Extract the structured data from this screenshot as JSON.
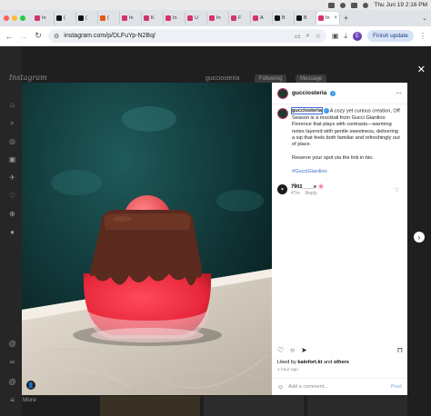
{
  "menubar": {
    "datetime": "Thu Jun 19  2:16 PM"
  },
  "tabs": [
    {
      "label": "In",
      "color": "#d6336c"
    },
    {
      "label": "(",
      "color": "#111111"
    },
    {
      "label": "(",
      "color": "#111111"
    },
    {
      "label": "(",
      "color": "#e8590c"
    },
    {
      "label": "In",
      "color": "#d6336c"
    },
    {
      "label": "K",
      "color": "#d6336c"
    },
    {
      "label": "In",
      "color": "#d6336c"
    },
    {
      "label": "U",
      "color": "#d6336c"
    },
    {
      "label": "In",
      "color": "#d6336c"
    },
    {
      "label": "F",
      "color": "#d6336c"
    },
    {
      "label": "A",
      "color": "#d6336c"
    },
    {
      "label": "B",
      "color": "#111111"
    },
    {
      "label": "B",
      "color": "#111111"
    },
    {
      "label": "In",
      "color": "#d6336c"
    }
  ],
  "toolbar": {
    "url": "instagram.com/p/DLFuYp-N2Bq/",
    "profile_initial": "E",
    "finish_update": "Finish update"
  },
  "page": {
    "logo": "Instagram",
    "bg_username": "gucciosteria",
    "bg_following": "Following",
    "bg_message": "Message",
    "more": "More"
  },
  "post": {
    "username": "gucciosteria",
    "caption_user": "gucciosteria",
    "caption": "A cozy yet curious creation, Off Season is a mocktail from Gucci Giardino Florence that plays with contrasts—warming notes layered with gentle sweetness, delivering a sip that feels both familiar and refreshingly out of place.",
    "caption2": "Reserve your spot via the link in bio.",
    "hashtag": "#GucciGiardino",
    "caption_age": "1h",
    "comment_user": "7902____x",
    "comment_emoji": "🌸",
    "comment_age": "47m",
    "reply": "Reply",
    "liked_prefix": "Liked by ",
    "liked_user": "kainfort.kt",
    "liked_and": " and ",
    "liked_others": "others",
    "post_age": "1 hour ago",
    "comment_placeholder": "Add a comment...",
    "post_button": "Post"
  },
  "colors": {
    "verified": "#3897f0",
    "link": "#3b73c4",
    "post_button": "#9ec0ef",
    "drink_red": "#e8283c",
    "chocolate": "#5a2a1e"
  }
}
